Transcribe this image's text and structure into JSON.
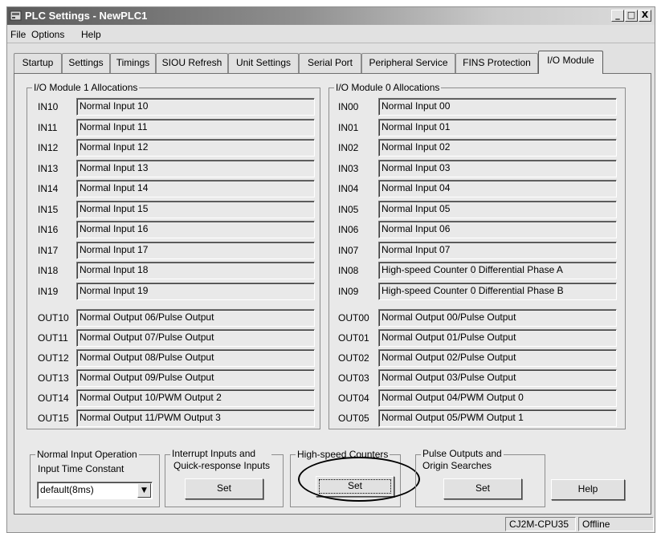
{
  "window": {
    "title": "PLC Settings - NewPLC1",
    "minimize": "_",
    "maximize": "□",
    "close": "X"
  },
  "menu": [
    "File",
    "Options",
    "Help"
  ],
  "tabs": [
    "Startup",
    "Settings",
    "Timings",
    "SIOU Refresh",
    "Unit Settings",
    "Serial Port",
    "Peripheral Service",
    "FINS Protection",
    "I/O Module"
  ],
  "active_tab": "I/O Module",
  "module1": {
    "title": "I/O Module 1 Allocations",
    "inputs": [
      {
        "label": "IN10",
        "value": "Normal Input 10"
      },
      {
        "label": "IN11",
        "value": "Normal Input 11"
      },
      {
        "label": "IN12",
        "value": "Normal Input 12"
      },
      {
        "label": "IN13",
        "value": "Normal Input 13"
      },
      {
        "label": "IN14",
        "value": "Normal Input 14"
      },
      {
        "label": "IN15",
        "value": "Normal Input 15"
      },
      {
        "label": "IN16",
        "value": "Normal Input 16"
      },
      {
        "label": "IN17",
        "value": "Normal Input 17"
      },
      {
        "label": "IN18",
        "value": "Normal Input 18"
      },
      {
        "label": "IN19",
        "value": "Normal Input 19"
      }
    ],
    "outputs": [
      {
        "label": "OUT10",
        "value": "Normal Output 06/Pulse Output"
      },
      {
        "label": "OUT11",
        "value": "Normal Output 07/Pulse Output"
      },
      {
        "label": "OUT12",
        "value": "Normal Output 08/Pulse Output"
      },
      {
        "label": "OUT13",
        "value": "Normal Output 09/Pulse Output"
      },
      {
        "label": "OUT14",
        "value": "Normal Output 10/PWM Output 2"
      },
      {
        "label": "OUT15",
        "value": "Normal Output 11/PWM Output 3"
      }
    ]
  },
  "module0": {
    "title": "I/O Module 0 Allocations",
    "inputs": [
      {
        "label": "IN00",
        "value": "Normal Input 00"
      },
      {
        "label": "IN01",
        "value": "Normal Input 01"
      },
      {
        "label": "IN02",
        "value": "Normal Input 02"
      },
      {
        "label": "IN03",
        "value": "Normal Input 03"
      },
      {
        "label": "IN04",
        "value": "Normal Input 04"
      },
      {
        "label": "IN05",
        "value": "Normal Input 05"
      },
      {
        "label": "IN06",
        "value": "Normal Input 06"
      },
      {
        "label": "IN07",
        "value": "Normal Input 07"
      },
      {
        "label": "IN08",
        "value": "High-speed Counter 0 Differential Phase A"
      },
      {
        "label": "IN09",
        "value": "High-speed Counter 0 Differential Phase B"
      }
    ],
    "outputs": [
      {
        "label": "OUT00",
        "value": "Normal Output 00/Pulse Output"
      },
      {
        "label": "OUT01",
        "value": "Normal Output 01/Pulse Output"
      },
      {
        "label": "OUT02",
        "value": "Normal Output 02/Pulse Output"
      },
      {
        "label": "OUT03",
        "value": "Normal Output 03/Pulse Output"
      },
      {
        "label": "OUT04",
        "value": "Normal Output 04/PWM Output 0"
      },
      {
        "label": "OUT05",
        "value": "Normal Output 05/PWM Output 1"
      }
    ]
  },
  "normal_input": {
    "title": "Normal Input Operation",
    "label": "Input Time Constant",
    "selected": "default(8ms)"
  },
  "interrupt": {
    "title_line1": "Interrupt Inputs and",
    "title_line2": "Quick-response Inputs",
    "button": "Set"
  },
  "hsc": {
    "title": "High-speed Counters",
    "button": "Set"
  },
  "pulse": {
    "title_line1": "Pulse Outputs and",
    "title_line2": "Origin Searches",
    "button": "Set"
  },
  "help_button": "Help",
  "status": {
    "model": "CJ2M-CPU35",
    "mode": "Offline"
  }
}
